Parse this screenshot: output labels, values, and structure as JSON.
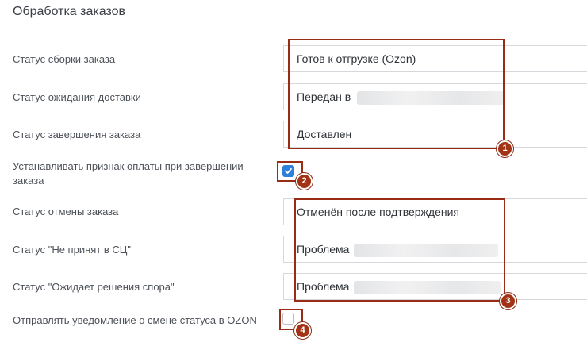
{
  "section": {
    "title": "Обработка заказов"
  },
  "rows": [
    {
      "label": "Статус сборки заказа",
      "value": "Готов к отгрузке (Ozon)"
    },
    {
      "label": "Статус ожидания доставки",
      "value": "Передан в"
    },
    {
      "label": "Статус завершения заказа",
      "value": "Доставлен"
    },
    {
      "label": "Устанавливать признак оплаты при завершении заказа",
      "checked": true
    },
    {
      "label": "Статус отмены заказа",
      "value": "Отменён после подтверждения"
    },
    {
      "label": "Статус \"Не принят в СЦ\"",
      "value": "Проблема"
    },
    {
      "label": "Статус \"Ожидает решения спора\"",
      "value": "Проблема"
    },
    {
      "label": "Отправлять уведомление о смене статуса в OZON",
      "checked": false
    }
  ],
  "annotations": [
    "1",
    "2",
    "3",
    "4"
  ],
  "colors": {
    "annotation": "#a23316",
    "checkbox_checked": "#2f7fd9",
    "field_border": "#d5d8dc"
  }
}
